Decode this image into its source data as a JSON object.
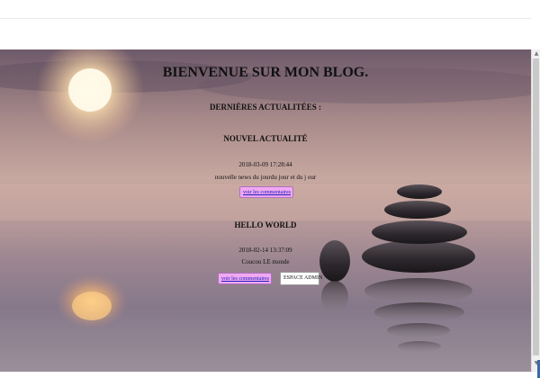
{
  "page": {
    "title": "BIENVENUE SUR MON BLOG.",
    "section_heading": "DERNIÈRES ACTUALITÉES :"
  },
  "posts": [
    {
      "title": "NOUVEL ACTUALITÉ",
      "date": "2018-03-09 17:28:44",
      "body": "nouvelle news du jourdu jour et du j our",
      "comments_label": "voir les commentaires"
    },
    {
      "title": "HELLO WORLD",
      "date": "2018-02-14 13:37:09",
      "body": "Coucou LE monde",
      "comments_label": "voir les commentaires"
    }
  ],
  "admin_button": {
    "label": "ESPACE ADMIN"
  },
  "scrollbar": {
    "up_icon": "▲",
    "down_icon": "▼"
  },
  "colors": {
    "comments_button_bg": "#f0a8f0",
    "link_text": "#2020c0",
    "admin_button_bg": "#ffffff"
  },
  "icons": {
    "background": "zen-stones-sunset-image"
  }
}
